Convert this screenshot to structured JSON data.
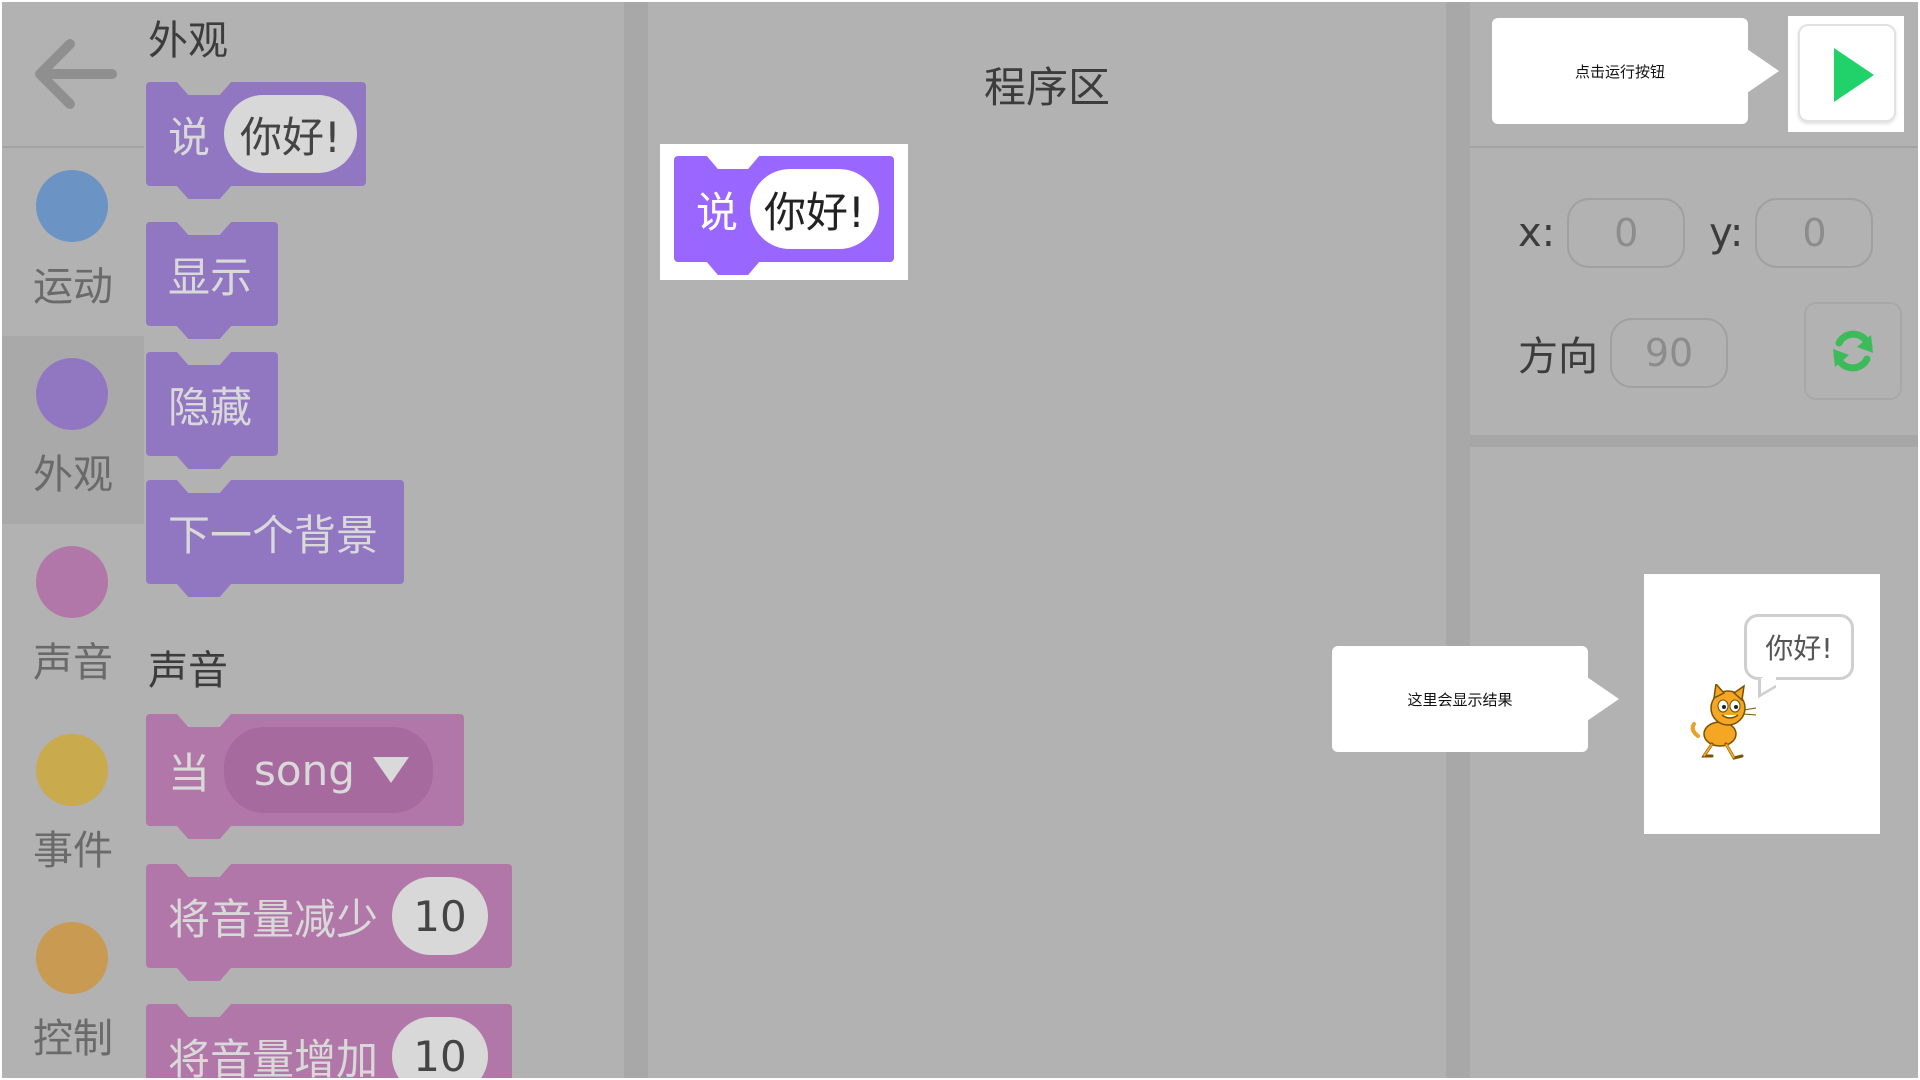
{
  "categories": [
    {
      "label": "运动",
      "color": "#6b93c4",
      "active": false
    },
    {
      "label": "外观",
      "color": "#9176c2",
      "active": true
    },
    {
      "label": "声音",
      "color": "#b277a9",
      "active": false
    },
    {
      "label": "事件",
      "color": "#c9aa4c",
      "active": false
    },
    {
      "label": "控制",
      "color": "#c89a52",
      "active": false
    }
  ],
  "palette": {
    "looks_title": "外观",
    "sound_title": "声音",
    "looks_blocks": {
      "say_label": "说",
      "say_value": "你好!",
      "show_label": "显示",
      "hide_label": "隐藏",
      "next_backdrop_label": "下一个背景"
    },
    "sound_blocks": {
      "when_label": "当",
      "when_value": "song",
      "decrease_label": "将音量减少",
      "decrease_value": "10",
      "increase_label": "将音量增加",
      "increase_value": "10"
    }
  },
  "program": {
    "title": "程序区",
    "say_label": "说",
    "say_value": "你好!"
  },
  "right_panel": {
    "run_hint": "点击运行按钮",
    "result_hint": "这里会显示结果",
    "x_label": "x:",
    "x_value": "0",
    "y_label": "y:",
    "y_value": "0",
    "direction_label": "方向",
    "direction_value": "90",
    "stage_speech": "你好!"
  },
  "icons": {
    "back": "back-arrow-icon",
    "run": "green-play-icon",
    "reset": "refresh-icon"
  },
  "colors": {
    "looks": "#9176c2",
    "sound": "#b277a9",
    "say_block": "#9966ff",
    "run_green": "#21d26b",
    "reset_green": "#3dbb5a"
  }
}
